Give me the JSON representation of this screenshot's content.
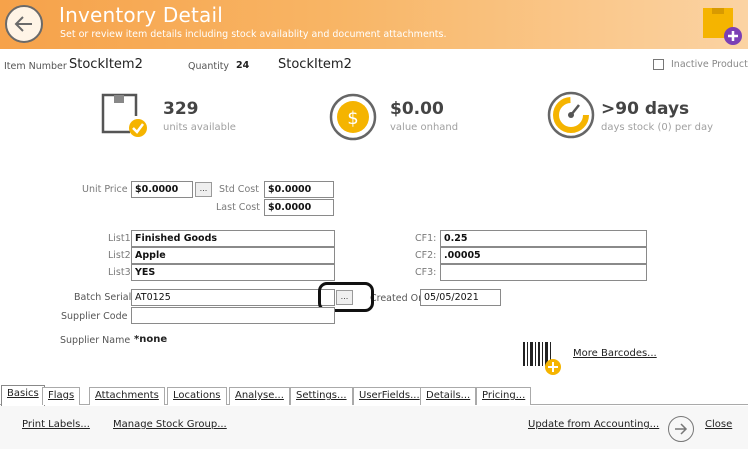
{
  "header": {
    "title": "Inventory Detail",
    "subtitle": "Set or review item details including stock availablity and document attachments."
  },
  "item": {
    "number_label": "Item Number",
    "number_value": "StockItem2",
    "quantity_label": "Quantity",
    "quantity_value": "24",
    "name_value": "StockItem2",
    "inactive_label": "Inactive Product"
  },
  "stats": [
    {
      "value": "329",
      "sub": "units available",
      "icon": "box-check-icon"
    },
    {
      "value": "$0.00",
      "sub": "value onhand",
      "icon": "dollar-coin-icon"
    },
    {
      "value": ">90 days",
      "sub": "days stock (0) per day",
      "icon": "gauge-icon"
    }
  ],
  "pricing": {
    "unit_price_label": "Unit Price",
    "unit_price_value": "$0.0000",
    "std_cost_label": "Std Cost",
    "std_cost_value": "$0.0000",
    "last_cost_label": "Last Cost",
    "last_cost_value": "$0.0000",
    "ellipsis": "..."
  },
  "lists": [
    {
      "label": "List1",
      "value": "Finished Goods"
    },
    {
      "label": "List2",
      "value": "Apple"
    },
    {
      "label": "List3",
      "value": "YES"
    }
  ],
  "custom_fields": [
    {
      "label": "CF1:",
      "value": "0.25"
    },
    {
      "label": "CF2:",
      "value": ".00005"
    },
    {
      "label": "CF3:",
      "value": ""
    }
  ],
  "batch": {
    "batch_label": "Batch Serial",
    "batch_value": "AT0125",
    "created_label": "Created On",
    "created_value": "05/05/2021",
    "supplier_code_label": "Supplier Code",
    "supplier_code_value": "",
    "supplier_name_label": "Supplier Name",
    "supplier_name_value": "*none"
  },
  "barcodes_link": "More Barcodes...",
  "tabs": [
    "Basics",
    "Flags",
    "Attachments",
    "Locations",
    "Analyse...",
    "Settings...",
    "UserFields...",
    "Details...",
    "Pricing..."
  ],
  "footer": {
    "print_labels": "Print Labels...",
    "manage_stock_group": "Manage Stock Group...",
    "update_from_accounting": "Update from Accounting...",
    "close": "Close"
  },
  "colors": {
    "header_orange": "#f6a24a",
    "accent_yellow": "#f5b400",
    "accent_purple": "#7b3fb5"
  }
}
